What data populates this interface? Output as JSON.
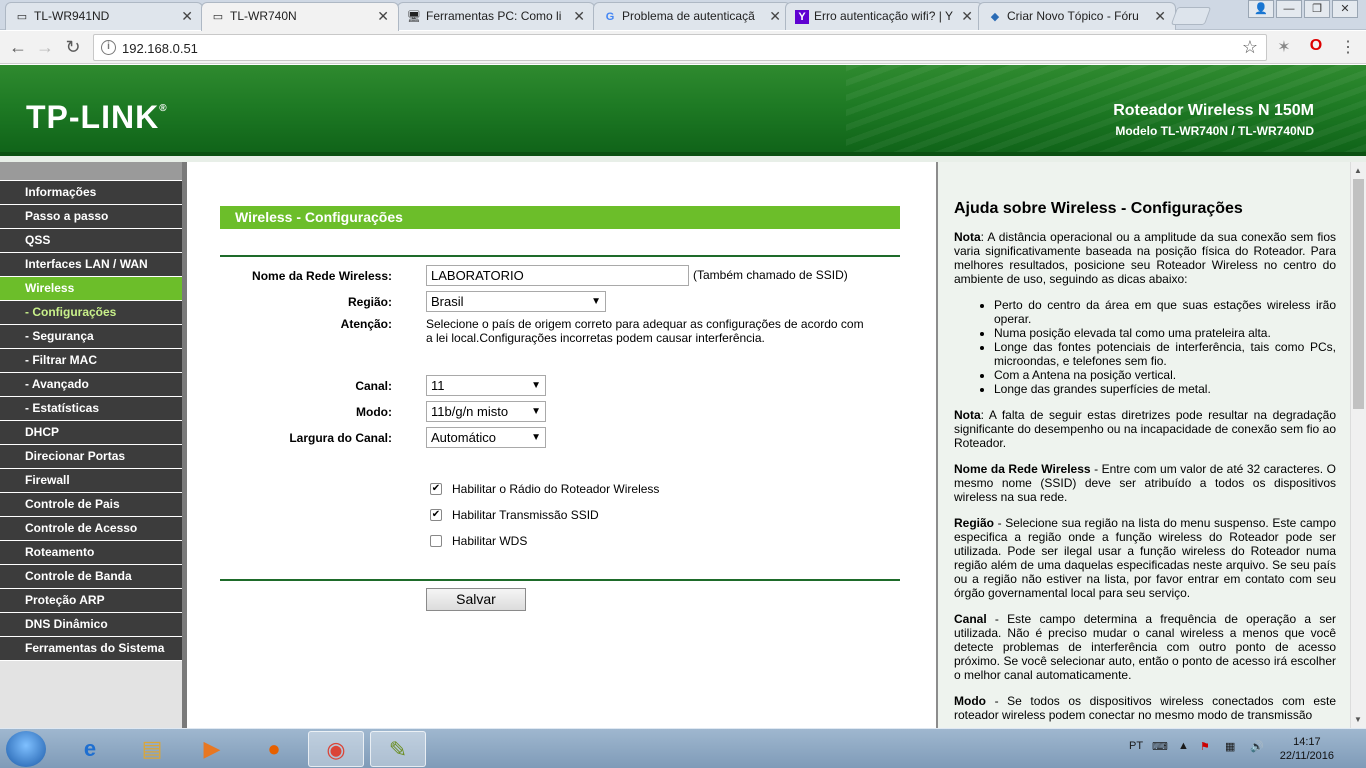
{
  "browser": {
    "tabs": [
      {
        "title": "TL-WR941ND",
        "icon": "page-icon",
        "active": false
      },
      {
        "title": "TL-WR740N",
        "icon": "page-icon",
        "active": true
      },
      {
        "title": "Ferramentas PC: Como li",
        "icon": "monitor-icon",
        "active": false
      },
      {
        "title": "Problema de autenticaçã",
        "icon": "google-icon",
        "active": false
      },
      {
        "title": "Erro autenticação wifi? | Y",
        "icon": "yahoo-icon",
        "active": false
      },
      {
        "title": "Criar Novo Tópico - Fóru",
        "icon": "forum-icon",
        "active": false
      }
    ],
    "url": "192.168.0.51"
  },
  "header": {
    "logo": "TP-LINK",
    "product_name": "Roteador Wireless N 150M",
    "product_model": "Modelo TL-WR740N / TL-WR740ND"
  },
  "menu": [
    {
      "label": "Informações",
      "active": false,
      "sub": false
    },
    {
      "label": "Passo a passo",
      "active": false,
      "sub": false
    },
    {
      "label": "QSS",
      "active": false,
      "sub": false
    },
    {
      "label": "Interfaces LAN / WAN",
      "active": false,
      "sub": false
    },
    {
      "label": "Wireless",
      "active": true,
      "sub": false
    },
    {
      "label": "- Configurações",
      "active": true,
      "sub": true
    },
    {
      "label": "- Segurança",
      "active": false,
      "sub": true
    },
    {
      "label": "- Filtrar MAC",
      "active": false,
      "sub": true
    },
    {
      "label": "- Avançado",
      "active": false,
      "sub": true
    },
    {
      "label": "- Estatísticas",
      "active": false,
      "sub": true
    },
    {
      "label": "DHCP",
      "active": false,
      "sub": false
    },
    {
      "label": "Direcionar Portas",
      "active": false,
      "sub": false
    },
    {
      "label": "Firewall",
      "active": false,
      "sub": false
    },
    {
      "label": "Controle de Pais",
      "active": false,
      "sub": false
    },
    {
      "label": "Controle de Acesso",
      "active": false,
      "sub": false
    },
    {
      "label": "Roteamento",
      "active": false,
      "sub": false
    },
    {
      "label": "Controle de Banda",
      "active": false,
      "sub": false
    },
    {
      "label": "Proteção ARP",
      "active": false,
      "sub": false
    },
    {
      "label": "DNS Dinâmico",
      "active": false,
      "sub": false
    },
    {
      "label": "Ferramentas do Sistema",
      "active": false,
      "sub": false
    }
  ],
  "form": {
    "title": "Wireless - Configurações",
    "ssid_label": "Nome da Rede Wireless:",
    "ssid_value": "LABORATORIO",
    "ssid_hint": "(Também chamado de SSID)",
    "region_label": "Região:",
    "region_value": "Brasil",
    "warning_label": "Atenção:",
    "warning_text": "Selecione o país de origem correto para adequar as configurações de acordo com a lei local.Configurações incorretas podem causar interferência.",
    "channel_label": "Canal:",
    "channel_value": "11",
    "mode_label": "Modo:",
    "mode_value": "11b/g/n misto",
    "width_label": "Largura do Canal:",
    "width_value": "Automático",
    "checkboxes": [
      {
        "label": "Habilitar o Rádio do Roteador Wireless",
        "checked": true
      },
      {
        "label": "Habilitar Transmissão SSID",
        "checked": true
      },
      {
        "label": "Habilitar WDS",
        "checked": false
      }
    ],
    "save_label": "Salvar"
  },
  "help": {
    "title": "Ajuda sobre Wireless - Configurações",
    "note1_label": "Nota",
    "note1_text": ": A distância operacional ou a amplitude da sua conexão sem fios varia significativamente baseada na posição física do Roteador. Para melhores resultados, posicione seu Roteador Wireless no centro do ambiente de uso, seguindo as dicas abaixo:",
    "tips": [
      "Perto do centro da área em que suas estações wireless irão operar.",
      "Numa posição elevada tal como uma prateleira alta.",
      "Longe das fontes potenciais de interferência, tais como PCs, microondas, e telefones sem fio.",
      "Com a Antena na posição vertical.",
      "Longe das grandes superfícies de metal."
    ],
    "note2_label": "Nota",
    "note2_text": ": A falta de seguir estas diretrizes pode resultar na degradação significante do desempenho ou na incapacidade de conexão sem fio ao Roteador.",
    "ssid_label": "Nome da Rede Wireless",
    "ssid_text": " - Entre com um valor de até 32 caracteres. O mesmo nome (SSID) deve ser atribuído a todos os dispositivos wireless na sua rede.",
    "region_label": "Região",
    "region_text": " - Selecione sua região na lista do menu suspenso. Este campo especifica a região onde a função wireless do Roteador pode ser utilizada. Pode ser ilegal usar a função wireless do Roteador numa região além de uma daquelas especificadas neste arquivo. Se seu país ou a região não estiver na lista, por favor entrar em contato com seu órgão governamental local para seu serviço.",
    "channel_label": "Canal",
    "channel_text": " - Este campo determina a frequência de operação a ser utilizada. Não é preciso mudar o canal wireless a menos que você detecte problemas de interferência com outro ponto de acesso próximo. Se você selecionar auto, então o ponto de acesso irá escolher o melhor canal automaticamente.",
    "mode_label": "Modo",
    "mode_text": " - Se todos os dispositivos wireless conectados com este roteador wireless podem conectar no mesmo modo de transmissão"
  },
  "taskbar": {
    "items": [
      "windows-start-icon",
      "internet-explorer-icon",
      "file-explorer-icon",
      "media-player-icon",
      "firefox-icon",
      "chrome-icon",
      "paint-icon"
    ],
    "lang": "PT",
    "time": "14:17",
    "date": "22/11/2016"
  }
}
